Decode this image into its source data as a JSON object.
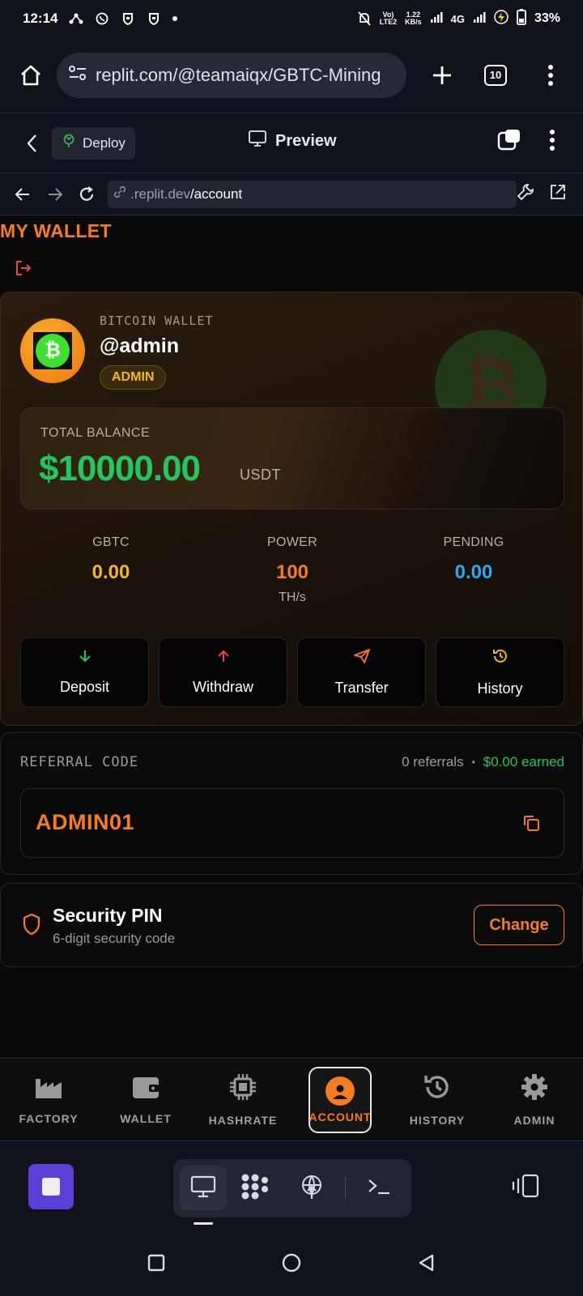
{
  "status_bar": {
    "time": "12:14",
    "net_label_top": "Vo)",
    "net_label_bottom": "LTE2",
    "speed_top": "1.22",
    "speed_bottom": "KB/s",
    "network": "4G",
    "battery": "33%"
  },
  "browser": {
    "url": "replit.com/@teamaiqx/GBTC-Mining",
    "tab_count": "10"
  },
  "replit_header": {
    "deploy_label": "Deploy",
    "preview_label": "Preview"
  },
  "replit_url": {
    "domain_part": ".replit.dev",
    "path_part": "/account"
  },
  "app": {
    "title": "MY WALLET",
    "wallet": {
      "label": "BITCOIN WALLET",
      "username": "@admin",
      "role": "ADMIN",
      "balance_label": "TOTAL BALANCE",
      "balance": "$10000.00",
      "balance_unit": "USDT"
    },
    "stats": [
      {
        "label": "GBTC",
        "value": "0.00",
        "unit": "",
        "color": "#f2b81f"
      },
      {
        "label": "POWER",
        "value": "100",
        "unit": "TH/s",
        "color": "#f57c1f"
      },
      {
        "label": "PENDING",
        "value": "0.00",
        "unit": "",
        "color": "#2ea7f0"
      }
    ],
    "actions": [
      {
        "label": "Deposit",
        "icon": "arrow-down-icon",
        "color": "#22c55e"
      },
      {
        "label": "Withdraw",
        "icon": "arrow-up-icon",
        "color": "#ef4444"
      },
      {
        "label": "Transfer",
        "icon": "send-icon",
        "color": "#f57c1f"
      },
      {
        "label": "History",
        "icon": "history-icon",
        "color": "#f2b81f"
      }
    ],
    "referral": {
      "label": "REFERRAL CODE",
      "count": "0 referrals",
      "separator": "•",
      "earned": "$0.00 earned",
      "code": "ADMIN01"
    },
    "security": {
      "title": "Security PIN",
      "subtitle": "6-digit security code",
      "button": "Change"
    }
  },
  "app_nav": [
    {
      "label": "FACTORY",
      "icon": "factory-icon"
    },
    {
      "label": "WALLET",
      "icon": "wallet-icon"
    },
    {
      "label": "HASHRATE",
      "icon": "chip-icon"
    },
    {
      "label": "ACCOUNT",
      "icon": "account-icon",
      "active": true
    },
    {
      "label": "HISTORY",
      "icon": "history-icon"
    },
    {
      "label": "ADMIN",
      "icon": "gear-icon"
    }
  ],
  "colors": {
    "accent": "#f57c1f",
    "green": "#22c55e",
    "replit_purple": "#5b3fd6"
  }
}
